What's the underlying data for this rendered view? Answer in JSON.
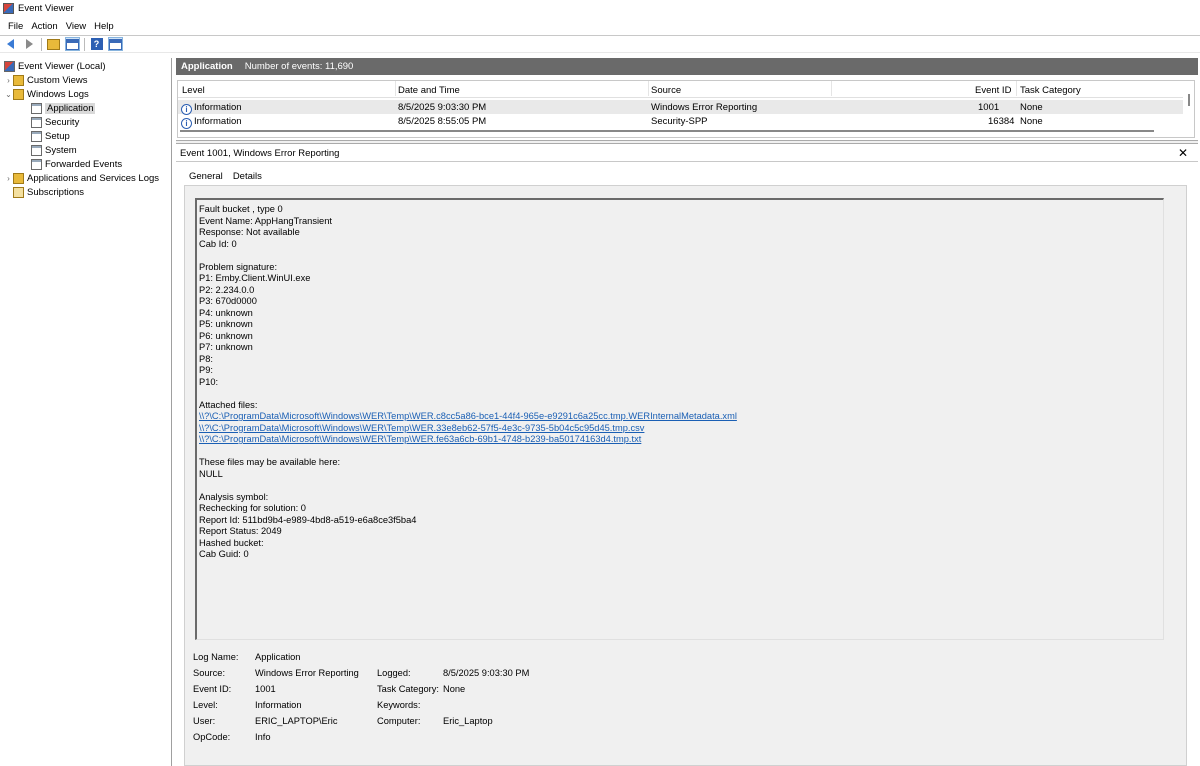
{
  "window": {
    "title": "Event Viewer"
  },
  "menu": [
    "File",
    "Action",
    "View",
    "Help"
  ],
  "tree": {
    "root": "Event Viewer (Local)",
    "custom_views": "Custom Views",
    "windows_logs": "Windows Logs",
    "logs": [
      "Application",
      "Security",
      "Setup",
      "System",
      "Forwarded Events"
    ],
    "apps_services": "Applications and Services Logs",
    "subscriptions": "Subscriptions"
  },
  "log_header": {
    "name": "Application",
    "count": "Number of events: 11,690"
  },
  "grid": {
    "columns": [
      "Level",
      "Date and Time",
      "Source",
      "Event ID",
      "Task Category"
    ],
    "rows": [
      {
        "level": "Information",
        "date": "8/5/2025 9:03:30 PM",
        "source": "Windows Error Reporting",
        "event_id": "1001",
        "task": "None"
      },
      {
        "level": "Information",
        "date": "8/5/2025 8:55:05 PM",
        "source": "Security-SPP",
        "event_id": "16384",
        "task": "None"
      }
    ]
  },
  "detail": {
    "title": "Event 1001, Windows Error Reporting",
    "tabs": [
      "General",
      "Details"
    ],
    "description": [
      "Fault bucket , type 0",
      "Event Name: AppHangTransient",
      "Response: Not available",
      "Cab Id: 0",
      "",
      "Problem signature:",
      "P1: Emby.Client.WinUI.exe",
      "P2: 2.234.0.0",
      "P3: 670d0000",
      "P4: unknown",
      "P5: unknown",
      "P6: unknown",
      "P7: unknown",
      "P8:",
      "P9:",
      "P10:",
      "",
      "Attached files:",
      "\\\\?\\C:\\ProgramData\\Microsoft\\Windows\\WER\\Temp\\WER.c8cc5a86-bce1-44f4-965e-e9291c6a25cc.tmp.WERInternalMetadata.xml",
      "\\\\?\\C:\\ProgramData\\Microsoft\\Windows\\WER\\Temp\\WER.33e8eb62-57f5-4e3c-9735-5b04c5c95d45.tmp.csv",
      "\\\\?\\C:\\ProgramData\\Microsoft\\Windows\\WER\\Temp\\WER.fe63a6cb-69b1-4748-b239-ba50174163d4.tmp.txt",
      "",
      "These files may be available here:",
      "NULL",
      "",
      "Analysis symbol:",
      "Rechecking for solution: 0",
      "Report Id: 511bd9b4-e989-4bd8-a519-e6a8ce3f5ba4",
      "Report Status: 2049",
      "Hashed bucket:",
      "Cab Guid: 0"
    ],
    "properties": {
      "log_name_label": "Log Name:",
      "log_name": "Application",
      "source_label": "Source:",
      "source": "Windows Error Reporting",
      "logged_label": "Logged:",
      "logged": "8/5/2025 9:03:30 PM",
      "event_id_label": "Event ID:",
      "event_id": "1001",
      "task_label": "Task Category:",
      "task": "None",
      "level_label": "Level:",
      "level": "Information",
      "keywords_label": "Keywords:",
      "user_label": "User:",
      "user": "ERIC_LAPTOP\\Eric",
      "computer_label": "Computer:",
      "computer": "Eric_Laptop",
      "opcode_label": "OpCode:",
      "opcode": "Info"
    }
  },
  "colors": {
    "header_bg": "#6a6a6a",
    "selected_row": "#e9e9e9",
    "link": "#1a5fb4",
    "pane_bg": "#f0f0f0"
  },
  "icons": [
    "event-viewer-icon",
    "back-arrow-icon",
    "forward-arrow-icon",
    "folder-up-icon",
    "show-pane-icon",
    "help-icon",
    "action-pane-icon",
    "information-icon",
    "close-icon"
  ]
}
